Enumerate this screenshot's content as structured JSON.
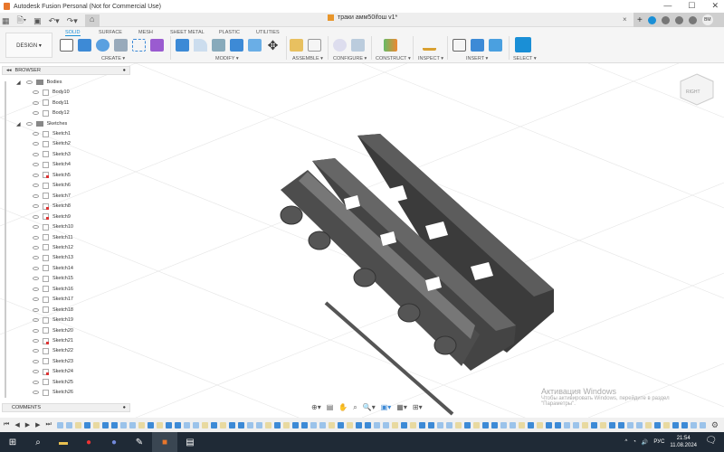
{
  "window": {
    "title": "Autodesk Fusion Personal (Not for Commercial Use)",
    "minimize": "—",
    "maximize": "☐",
    "close": "✕"
  },
  "document": {
    "tab_title": "траки амм50ifош v1*",
    "close": "×"
  },
  "user": {
    "initials": "BM"
  },
  "toolbar": {
    "workspace": "DESIGN ▾",
    "tabs": [
      "SOLID",
      "SURFACE",
      "MESH",
      "SHEET METAL",
      "PLASTIC",
      "UTILITIES"
    ],
    "groups": [
      "CREATE ▾",
      "MODIFY ▾",
      "ASSEMBLE ▾",
      "CONFIGURE ▾",
      "CONSTRUCT ▾",
      "INSPECT ▾",
      "INSERT ▾",
      "SELECT ▾"
    ]
  },
  "browser": {
    "title": "BROWSER",
    "bodies_label": "Bodies",
    "bodies": [
      "Body10",
      "Body11",
      "Body12"
    ],
    "sketches_label": "Sketches",
    "sketches": [
      "Sketch1",
      "Sketch2",
      "Sketch3",
      "Sketch4",
      "Sketch5",
      "Sketch6",
      "Sketch7",
      "Sketch8",
      "Sketch9",
      "Sketch10",
      "Sketch11",
      "Sketch12",
      "Sketch13",
      "Sketch14",
      "Sketch15",
      "Sketch16",
      "Sketch17",
      "Sketch18",
      "Sketch19",
      "Sketch20",
      "Sketch21",
      "Sketch22",
      "Sketch23",
      "Sketch24",
      "Sketch25",
      "Sketch26"
    ]
  },
  "comments": {
    "title": "COMMENTS"
  },
  "watermark": {
    "line1": "Активация Windows",
    "line2": "Чтобы активировать Windows, перейдите в раздел",
    "line3": "\"Параметры\"."
  },
  "viewcube": {
    "label": "RIGHT"
  },
  "taskbar": {
    "lang": "РУС",
    "time": "21:54",
    "date": "11.08.2024"
  },
  "colors": {
    "accent": "#1a8fd6",
    "model": "#4a4a4a",
    "taskbar": "#1f2a36"
  }
}
